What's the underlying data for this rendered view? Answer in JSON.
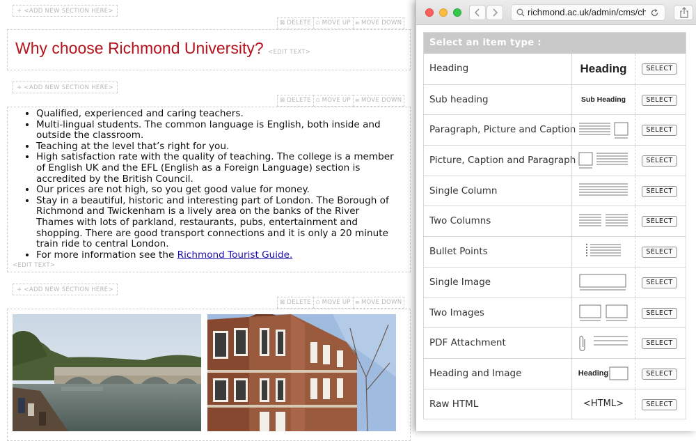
{
  "editor": {
    "add_section": "+ <ADD NEW SECTION HERE>",
    "delete": "⊠ DELETE",
    "move_up": "⩍ MOVE UP",
    "move_down": "⩎ MOVE DOWN",
    "edit_text": "<EDIT TEXT>",
    "heading": "Why choose Richmond University?",
    "bullets": [
      "Qualified, experienced and caring teachers.",
      "Multi-lingual students. The common language is English, both inside and outside the classroom.",
      "Teaching at the level that’s right for you.",
      "High satisfaction rate with the quality of teaching. The college is a member of English UK and the EFL (English as a Foreign Language) section is accredited by the British Council.",
      "Our prices are not high, so you get good value for money.",
      "Stay in a beautiful, historic and interesting part of London. The Borough of Richmond and Twickenham is a lively area on the banks of the River Thames with lots of parkland, restaurants, pubs, entertainment and shopping. There are good transport connections and it is only a 20 minute train ride to central London."
    ],
    "last_bullet_prefix": "For more information see the ",
    "last_bullet_link": "Richmond Tourist Guide."
  },
  "browser": {
    "url": "richmond.ac.uk/admin/cms/ch"
  },
  "selector": {
    "title": "Select an item type :",
    "select_label": "SELECT",
    "items": [
      {
        "label": "Heading",
        "preview": "Heading"
      },
      {
        "label": "Sub heading",
        "preview": "Sub Heading"
      },
      {
        "label": "Paragraph, Picture and Caption"
      },
      {
        "label": "Picture, Caption and Paragraph"
      },
      {
        "label": "Single Column"
      },
      {
        "label": "Two Columns"
      },
      {
        "label": "Bullet Points"
      },
      {
        "label": "Single Image"
      },
      {
        "label": "Two Images"
      },
      {
        "label": "PDF Attachment"
      },
      {
        "label": "Heading and Image",
        "preview": "Heading"
      },
      {
        "label": "Raw HTML",
        "preview": "<HTML>"
      }
    ]
  }
}
